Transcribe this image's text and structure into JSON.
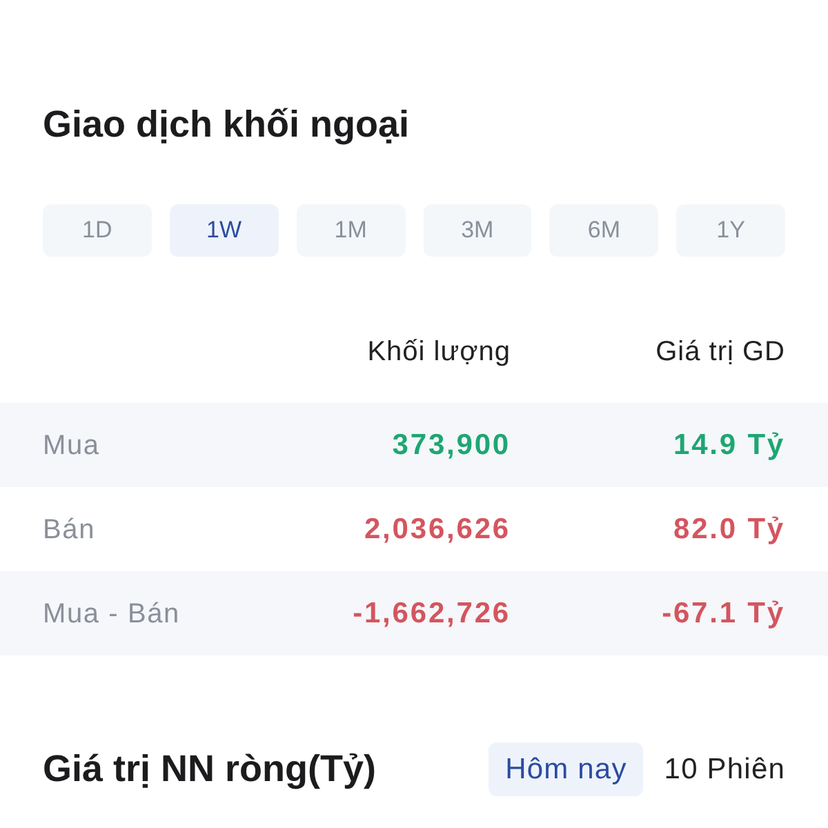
{
  "foreign_trading": {
    "title": "Giao dịch khối ngoại",
    "periods": [
      {
        "label": "1D",
        "selected": false
      },
      {
        "label": "1W",
        "selected": true
      },
      {
        "label": "1M",
        "selected": false
      },
      {
        "label": "3M",
        "selected": false
      },
      {
        "label": "6M",
        "selected": false
      },
      {
        "label": "1Y",
        "selected": false
      }
    ]
  },
  "table": {
    "columns": [
      "Khối lượng",
      "Giá trị GD"
    ],
    "rows": [
      {
        "label": "Mua",
        "volume": "373,900",
        "value": "14.9 Tỷ",
        "color": "#1ea672"
      },
      {
        "label": "Bán",
        "volume": "2,036,626",
        "value": "82.0 Tỷ",
        "color": "#d4555f"
      },
      {
        "label": "Mua - Bán",
        "volume": "-1,662,726",
        "value": "-67.1 Tỷ",
        "color": "#d4555f"
      }
    ]
  },
  "net_value": {
    "title": "Giá trị NN ròng(Tỷ)",
    "ranges": [
      {
        "label": "Hôm nay",
        "selected": true
      },
      {
        "label": "10 Phiên",
        "selected": false
      }
    ]
  }
}
